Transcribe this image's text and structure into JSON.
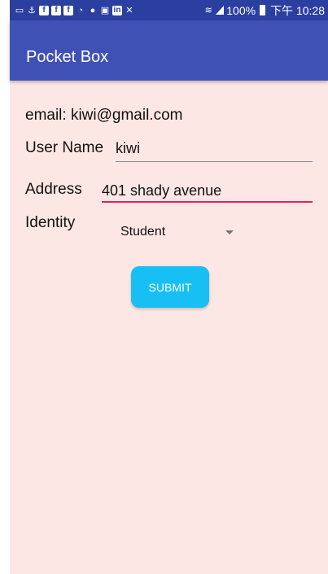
{
  "status_bar": {
    "battery": "100%",
    "time": "下午 10:28",
    "icons": [
      "chat-icon",
      "notification-icon",
      "facebook-icon",
      "facebook-icon",
      "facebook-icon",
      "weibo-icon",
      "wechat-icon",
      "gallery-icon",
      "linkedin-icon",
      "mute-icon",
      "wifi-icon",
      "signal-icon",
      "battery-icon"
    ]
  },
  "app_bar": {
    "title": "Pocket Box",
    "color": "#3f51b5"
  },
  "form": {
    "email_text": "email: kiwi@gmail.com",
    "username_label": "User Name",
    "username_value": "kiwi",
    "address_label": "Address",
    "address_value": "401 shady avenue",
    "identity_label": "Identity",
    "identity_value": "Student",
    "submit_label": "SUBMIT"
  },
  "colors": {
    "background": "#fde7e4",
    "submit": "#18bff5",
    "active_underline": "#e91e63"
  }
}
